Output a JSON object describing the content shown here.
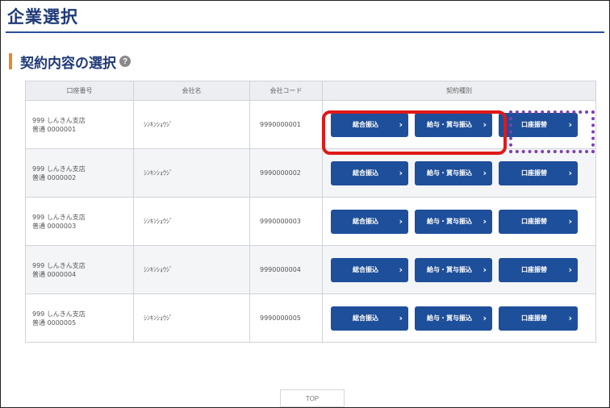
{
  "page": {
    "title": "企業選択",
    "section_title": "契約内容の選択",
    "help_icon": "question-circle-icon"
  },
  "table": {
    "headers": [
      "口座番号",
      "会社名",
      "会社コード",
      "契約種別"
    ],
    "rows": [
      {
        "bank": "999 しんきん支店",
        "account": "普通 0000001",
        "company": "ｼﾝｷﾝｼｮｳｼﾞ",
        "code": "9990000001",
        "btn1": "総合振込",
        "btn2": "給与・賞与振込",
        "btn3": "口座振替"
      },
      {
        "bank": "999 しんきん支店",
        "account": "普通 0000002",
        "company": "ｼﾝｷﾝｼｮｳｼﾞ",
        "code": "9990000002",
        "btn1": "総合振込",
        "btn2": "給与・賞与振込",
        "btn3": "口座振替"
      },
      {
        "bank": "999 しんきん支店",
        "account": "普通 0000003",
        "company": "ｼﾝｷﾝｼｮｳｼﾞ",
        "code": "9990000003",
        "btn1": "総合振込",
        "btn2": "給与・賞与振込",
        "btn3": "口座振替"
      },
      {
        "bank": "999 しんきん支店",
        "account": "普通 0000004",
        "company": "ｼﾝｷﾝｼｮｳｼﾞ",
        "code": "9990000004",
        "btn1": "総合振込",
        "btn2": "給与・賞与振込",
        "btn3": "口座振替"
      },
      {
        "bank": "999 しんきん支店",
        "account": "普通 0000005",
        "company": "ｼﾝｷﾝｼｮｳｼﾞ",
        "code": "9990000005",
        "btn1": "総合振込",
        "btn2": "給与・賞与振込",
        "btn3": "口座振替"
      }
    ]
  },
  "footer": {
    "top_button": "TOP"
  },
  "colors": {
    "title_blue": "#1f3a78",
    "button_blue": "#1e4f9a",
    "section_accent": "#e58a2a",
    "highlight_red": "#e01919",
    "highlight_purple": "#7b3fb3"
  }
}
